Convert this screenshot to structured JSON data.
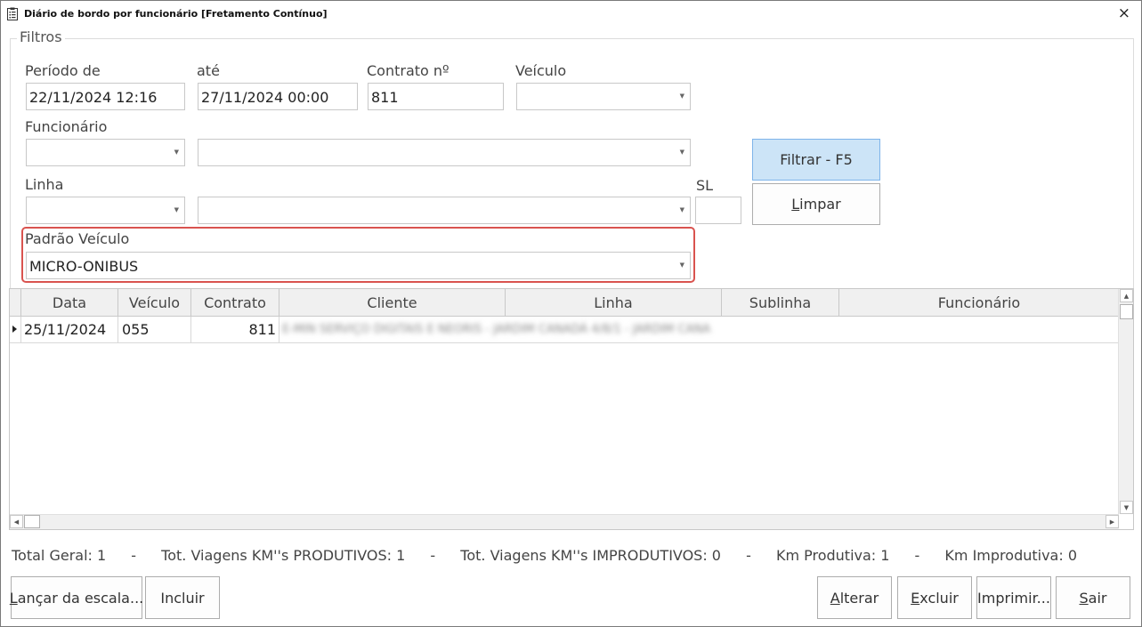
{
  "window": {
    "title": "Diário de bordo por funcionário [Fretamento Contínuo]",
    "close_glyph": "×",
    "title_icon": "clipboard-icon"
  },
  "filters": {
    "legend": "Filtros",
    "periodo_de_label": "Período de",
    "periodo_de_value": "22/11/2024 12:16",
    "ate_label": "até",
    "ate_value": "27/11/2024 00:00",
    "contrato_label": "Contrato nº",
    "contrato_value": "811",
    "veiculo_label": "Veículo",
    "veiculo_value": "",
    "funcionario_label": "Funcionário",
    "funcionario_code_value": "",
    "funcionario_name_value": "",
    "linha_label": "Linha",
    "linha_code_value": "",
    "linha_name_value": "",
    "sl_label": "SL",
    "sl_value": "",
    "padrao_veiculo_label": "Padrão Veículo",
    "padrao_veiculo_value": "MICRO-ONIBUS",
    "filtrar_button": "Filtrar - F5",
    "limpar_button_first": "L",
    "limpar_button_rest": "impar",
    "highlight_color": "#d9534f"
  },
  "grid": {
    "columns": [
      "Data",
      "Veículo",
      "Contrato",
      "Cliente",
      "Linha",
      "Sublinha",
      "Funcionário"
    ],
    "rows": [
      {
        "data": "25/11/2024",
        "veiculo": "055",
        "contrato": "811",
        "redacted": "E-MIN SERVIÇO DIGITAIS E NEORIS - JARDIM CANADÁ 4/8/1 - JARDIM CANA"
      }
    ]
  },
  "status": {
    "total_geral": "Total Geral: 1",
    "sep": "-",
    "produtivos": "Tot. Viagens KM''s PRODUTIVOS: 1",
    "improdutivos": "Tot. Viagens KM''s IMPRODUTIVOS: 0",
    "km_produtiva": "Km Produtiva: 1",
    "km_improdutiva": "Km Improdutiva: 0"
  },
  "actions": {
    "lancar_first": "L",
    "lancar_rest": "ançar da escala...",
    "incluir": "Incluir",
    "alterar_first": "A",
    "alterar_rest": "lterar",
    "excluir_first": "E",
    "excluir_rest": "xcluir",
    "imprimir": "Imprimir...",
    "sair_first": "S",
    "sair_rest": "air"
  }
}
